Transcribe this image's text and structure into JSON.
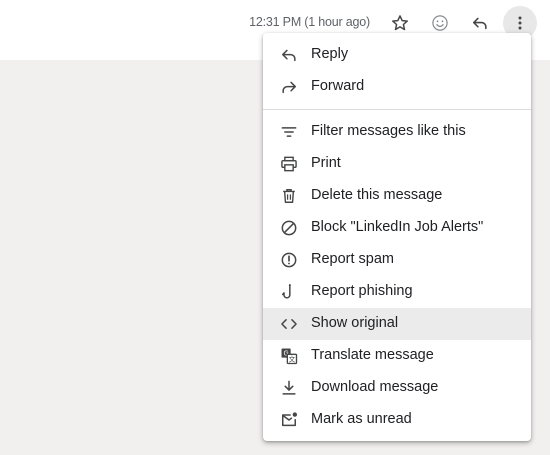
{
  "header": {
    "timestamp": "12:31 PM (1 hour ago)"
  },
  "menu": {
    "items": [
      {
        "label": "Reply",
        "icon": "reply-icon"
      },
      {
        "label": "Forward",
        "icon": "forward-icon"
      },
      {
        "label": "Filter messages like this",
        "icon": "filter-icon"
      },
      {
        "label": "Print",
        "icon": "print-icon"
      },
      {
        "label": "Delete this message",
        "icon": "trash-icon"
      },
      {
        "label": "Block \"LinkedIn Job Alerts\"",
        "icon": "block-icon"
      },
      {
        "label": "Report spam",
        "icon": "report-spam-icon"
      },
      {
        "label": "Report phishing",
        "icon": "phishing-hook-icon"
      },
      {
        "label": "Show original",
        "icon": "code-icon"
      },
      {
        "label": "Translate message",
        "icon": "translate-icon"
      },
      {
        "label": "Download message",
        "icon": "download-icon"
      },
      {
        "label": "Mark as unread",
        "icon": "mark-unread-icon"
      }
    ],
    "highlighted_item": "Show original"
  }
}
